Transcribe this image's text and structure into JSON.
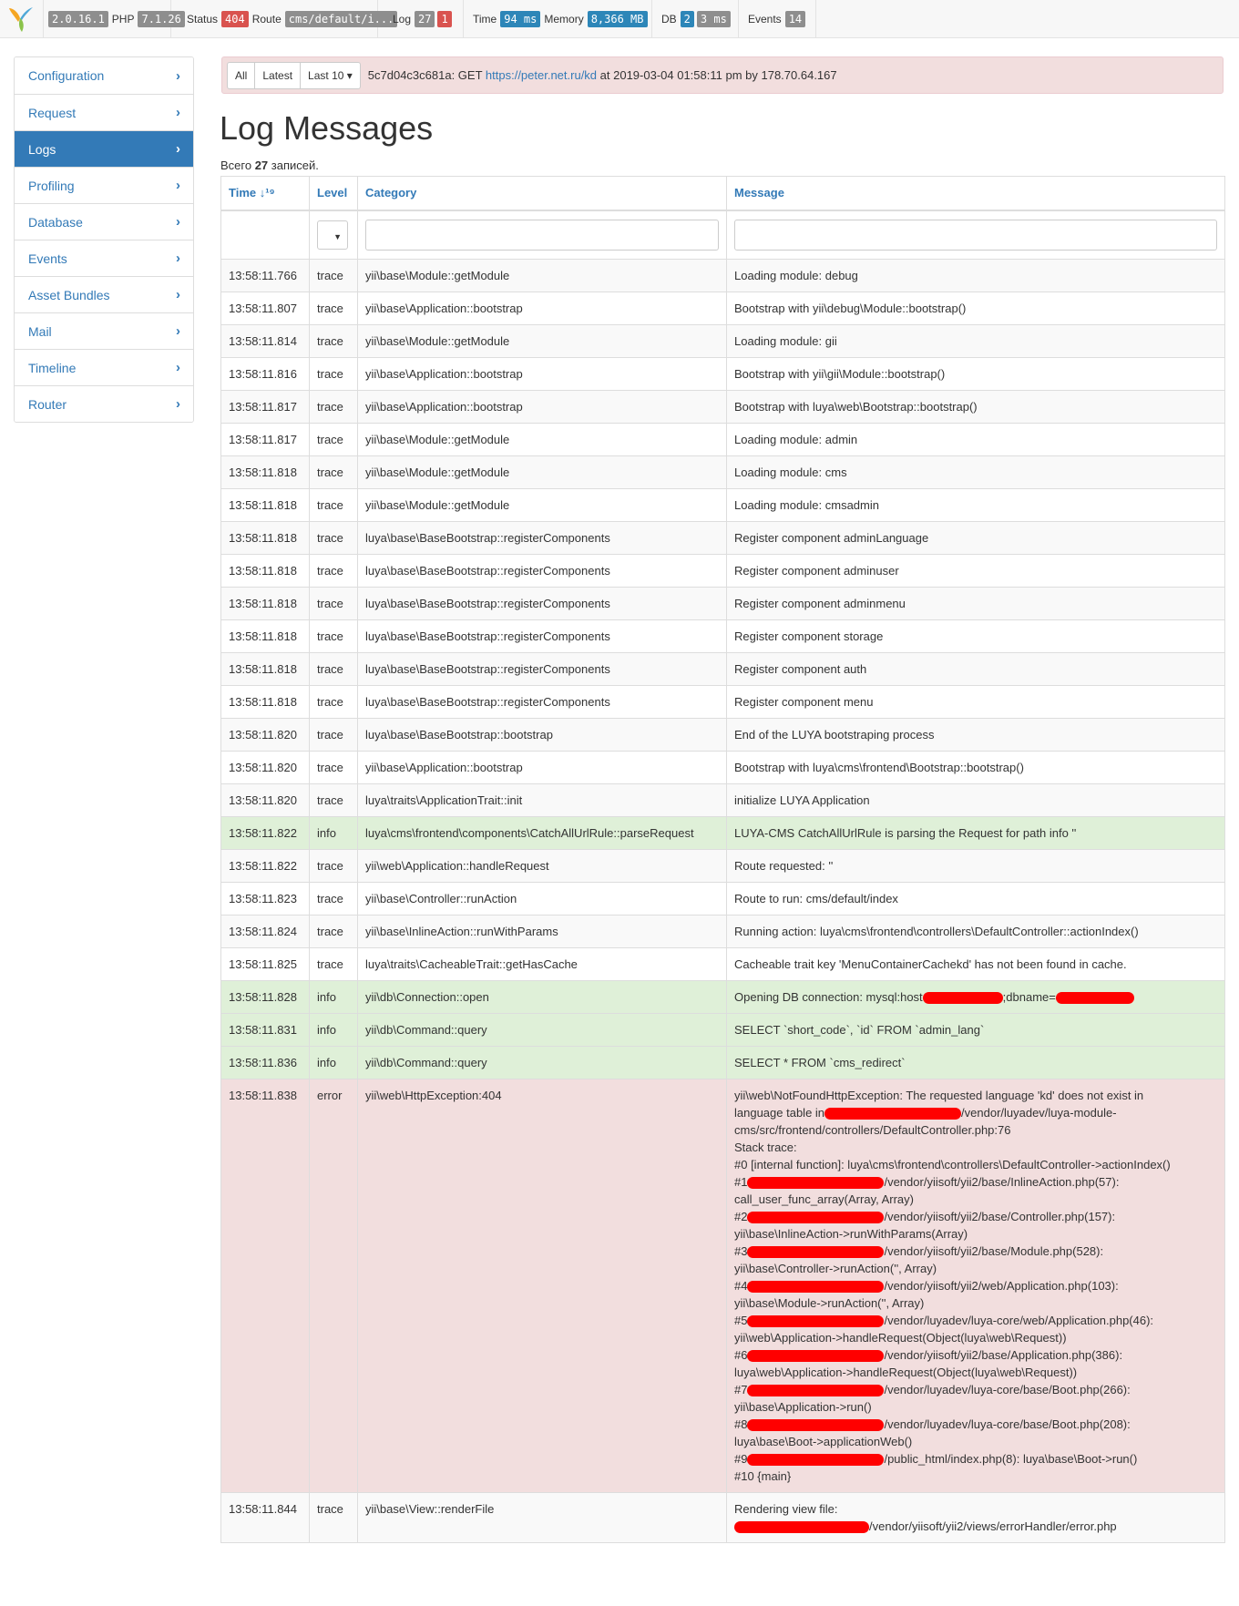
{
  "toolbar": {
    "version": "2.0.16.1",
    "php_label": "PHP",
    "php_version": "7.1.26",
    "status_label": "Status",
    "status_code": "404",
    "route_label": "Route",
    "route_value": "cms/default/i...",
    "log_label": "Log",
    "log_count": "27",
    "log_errors": "1",
    "time_label": "Time",
    "time_value": "94 ms",
    "memory_label": "Memory",
    "memory_value": "8,366 MB",
    "db_label": "DB",
    "db_count": "2",
    "db_time": "3 ms",
    "events_label": "Events",
    "events_count": "14"
  },
  "sidebar": {
    "items": [
      {
        "label": "Configuration"
      },
      {
        "label": "Request"
      },
      {
        "label": "Logs",
        "active": true
      },
      {
        "label": "Profiling"
      },
      {
        "label": "Database"
      },
      {
        "label": "Events"
      },
      {
        "label": "Asset Bundles"
      },
      {
        "label": "Mail"
      },
      {
        "label": "Timeline"
      },
      {
        "label": "Router"
      }
    ]
  },
  "summary": {
    "buttons": [
      "All",
      "Latest",
      "Last 10 ▾"
    ],
    "tag": "5c7d04c3c681a: GET ",
    "url": "https://peter.net.ru/kd",
    "rest": " at 2019-03-04 01:58:11 pm by 178.70.64.167"
  },
  "page": {
    "title": "Log Messages",
    "total_prefix": "Всего ",
    "total_count": "27",
    "total_suffix": " записей."
  },
  "table": {
    "headers": {
      "time": "Time ↓¹⁹",
      "level": "Level",
      "category": "Category",
      "message": "Message"
    },
    "rows": [
      {
        "time": "13:58:11.766",
        "level": "trace",
        "category": "yii\\base\\Module::getModule",
        "message": "Loading module: debug"
      },
      {
        "time": "13:58:11.807",
        "level": "trace",
        "category": "yii\\base\\Application::bootstrap",
        "message": "Bootstrap with yii\\debug\\Module::bootstrap()"
      },
      {
        "time": "13:58:11.814",
        "level": "trace",
        "category": "yii\\base\\Module::getModule",
        "message": "Loading module: gii"
      },
      {
        "time": "13:58:11.816",
        "level": "trace",
        "category": "yii\\base\\Application::bootstrap",
        "message": "Bootstrap with yii\\gii\\Module::bootstrap()"
      },
      {
        "time": "13:58:11.817",
        "level": "trace",
        "category": "yii\\base\\Application::bootstrap",
        "message": "Bootstrap with luya\\web\\Bootstrap::bootstrap()"
      },
      {
        "time": "13:58:11.817",
        "level": "trace",
        "category": "yii\\base\\Module::getModule",
        "message": "Loading module: admin"
      },
      {
        "time": "13:58:11.818",
        "level": "trace",
        "category": "yii\\base\\Module::getModule",
        "message": "Loading module: cms"
      },
      {
        "time": "13:58:11.818",
        "level": "trace",
        "category": "yii\\base\\Module::getModule",
        "message": "Loading module: cmsadmin"
      },
      {
        "time": "13:58:11.818",
        "level": "trace",
        "category": "luya\\base\\BaseBootstrap::registerComponents",
        "message": "Register component adminLanguage"
      },
      {
        "time": "13:58:11.818",
        "level": "trace",
        "category": "luya\\base\\BaseBootstrap::registerComponents",
        "message": "Register component adminuser"
      },
      {
        "time": "13:58:11.818",
        "level": "trace",
        "category": "luya\\base\\BaseBootstrap::registerComponents",
        "message": "Register component adminmenu"
      },
      {
        "time": "13:58:11.818",
        "level": "trace",
        "category": "luya\\base\\BaseBootstrap::registerComponents",
        "message": "Register component storage"
      },
      {
        "time": "13:58:11.818",
        "level": "trace",
        "category": "luya\\base\\BaseBootstrap::registerComponents",
        "message": "Register component auth"
      },
      {
        "time": "13:58:11.818",
        "level": "trace",
        "category": "luya\\base\\BaseBootstrap::registerComponents",
        "message": "Register component menu"
      },
      {
        "time": "13:58:11.820",
        "level": "trace",
        "category": "luya\\base\\BaseBootstrap::bootstrap",
        "message": "End of the LUYA bootstraping process"
      },
      {
        "time": "13:58:11.820",
        "level": "trace",
        "category": "yii\\base\\Application::bootstrap",
        "message": "Bootstrap with luya\\cms\\frontend\\Bootstrap::bootstrap()"
      },
      {
        "time": "13:58:11.820",
        "level": "trace",
        "category": "luya\\traits\\ApplicationTrait::init",
        "message": "initialize LUYA Application"
      },
      {
        "time": "13:58:11.822",
        "level": "info",
        "category": "luya\\cms\\frontend\\components\\CatchAllUrlRule::parseRequest",
        "message": "LUYA-CMS CatchAllUrlRule is parsing the Request for path info ''"
      },
      {
        "time": "13:58:11.822",
        "level": "trace",
        "category": "yii\\web\\Application::handleRequest",
        "message": "Route requested: ''"
      },
      {
        "time": "13:58:11.823",
        "level": "trace",
        "category": "yii\\base\\Controller::runAction",
        "message": "Route to run: cms/default/index"
      },
      {
        "time": "13:58:11.824",
        "level": "trace",
        "category": "yii\\base\\InlineAction::runWithParams",
        "message": "Running action: luya\\cms\\frontend\\controllers\\DefaultController::actionIndex()"
      },
      {
        "time": "13:58:11.825",
        "level": "trace",
        "category": "luya\\traits\\CacheableTrait::getHasCache",
        "message": "Cacheable trait key 'MenuContainerCachekd' has not been found in cache."
      },
      {
        "time": "13:58:11.828",
        "level": "info",
        "category": "yii\\db\\Connection::open",
        "message": "Opening DB connection: mysql:host",
        "message2": ";dbname="
      },
      {
        "time": "13:58:11.831",
        "level": "info",
        "category": "yii\\db\\Command::query",
        "message": "SELECT `short_code`, `id` FROM `admin_lang`"
      },
      {
        "time": "13:58:11.836",
        "level": "info",
        "category": "yii\\db\\Command::query",
        "message": "SELECT * FROM `cms_redirect`"
      }
    ],
    "error_row": {
      "time": "13:58:11.838",
      "level": "error",
      "category": "yii\\web\\HttpException:404",
      "lines": [
        {
          "pre": "yii\\web\\NotFoundHttpException: The requested language 'kd' does not exist in"
        },
        {
          "pre": "language table in",
          "red": 150,
          "post": "/vendor/luyadev/luya-module-"
        },
        {
          "pre": "cms/src/frontend/controllers/DefaultController.php:76"
        },
        {
          "pre": "Stack trace:"
        },
        {
          "pre": "#0 [internal function]: luya\\cms\\frontend\\controllers\\DefaultController->actionIndex()"
        },
        {
          "pre": "#1",
          "red": 150,
          "post": "/vendor/yiisoft/yii2/base/InlineAction.php(57):"
        },
        {
          "pre": "call_user_func_array(Array, Array)"
        },
        {
          "pre": "#2",
          "red": 150,
          "post": "/vendor/yiisoft/yii2/base/Controller.php(157):"
        },
        {
          "pre": "yii\\base\\InlineAction->runWithParams(Array)"
        },
        {
          "pre": "#3",
          "red": 150,
          "post": "/vendor/yiisoft/yii2/base/Module.php(528):"
        },
        {
          "pre": "yii\\base\\Controller->runAction('', Array)"
        },
        {
          "pre": "#4",
          "red": 150,
          "post": "/vendor/yiisoft/yii2/web/Application.php(103):"
        },
        {
          "pre": "yii\\base\\Module->runAction('', Array)"
        },
        {
          "pre": "#5",
          "red": 150,
          "post": "/vendor/luyadev/luya-core/web/Application.php(46):"
        },
        {
          "pre": "yii\\web\\Application->handleRequest(Object(luya\\web\\Request))"
        },
        {
          "pre": "#6",
          "red": 150,
          "post": "/vendor/yiisoft/yii2/base/Application.php(386):"
        },
        {
          "pre": "luya\\web\\Application->handleRequest(Object(luya\\web\\Request))"
        },
        {
          "pre": "#7",
          "red": 150,
          "post": "/vendor/luyadev/luya-core/base/Boot.php(266):"
        },
        {
          "pre": "yii\\base\\Application->run()"
        },
        {
          "pre": "#8",
          "red": 150,
          "post": "/vendor/luyadev/luya-core/base/Boot.php(208):"
        },
        {
          "pre": "luya\\base\\Boot->applicationWeb()"
        },
        {
          "pre": "#9",
          "red": 150,
          "post": "/public_html/index.php(8): luya\\base\\Boot->run()"
        },
        {
          "pre": "#10 {main}"
        }
      ]
    },
    "last_row": {
      "time": "13:58:11.844",
      "level": "trace",
      "category": "yii\\base\\View::renderFile",
      "message_line1": "Rendering view file:",
      "message_line2": "/vendor/yiisoft/yii2/views/errorHandler/error.php"
    }
  }
}
